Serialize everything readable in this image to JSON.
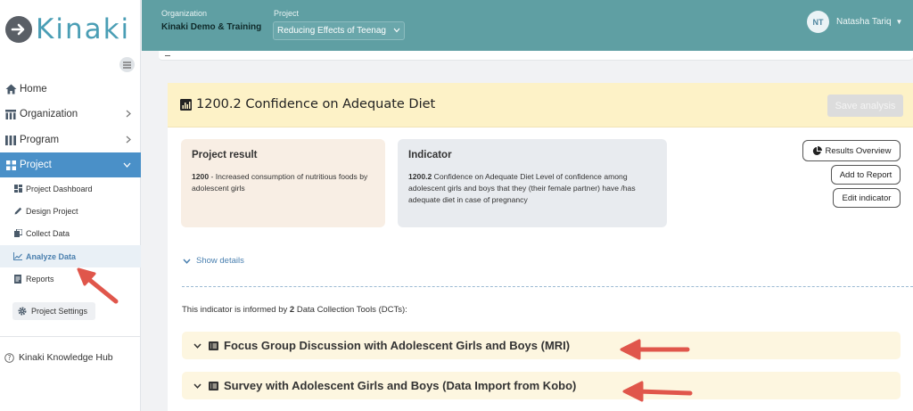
{
  "brand": {
    "name": "Kinaki"
  },
  "sidebar": {
    "nav": [
      {
        "label": "Home",
        "icon": "home-icon",
        "has_chevron": false
      },
      {
        "label": "Organization",
        "icon": "organization-icon",
        "has_chevron": true
      },
      {
        "label": "Program",
        "icon": "program-icon",
        "has_chevron": true
      },
      {
        "label": "Project",
        "icon": "project-icon",
        "has_chevron": true,
        "active": true
      }
    ],
    "project_items": [
      {
        "label": "Project Dashboard",
        "icon": "dashboard-icon"
      },
      {
        "label": "Design Project",
        "icon": "pencil-icon"
      },
      {
        "label": "Collect Data",
        "icon": "collect-data-icon"
      },
      {
        "label": "Analyze Data",
        "icon": "chart-line-icon",
        "current": true
      },
      {
        "label": "Reports",
        "icon": "report-icon"
      }
    ],
    "settings_label": "Project Settings",
    "knowledge_hub_label": "Kinaki Knowledge Hub"
  },
  "header": {
    "organization_label": "Organization",
    "organization_value": "Kinaki Demo & Training",
    "project_label": "Project",
    "project_value": "Reducing Effects of Teenag",
    "user_initials": "NT",
    "user_name": "Natasha Tariq"
  },
  "card": {
    "title": "1200.2 Confidence on Adequate Diet",
    "save_label": "Save analysis",
    "project_result": {
      "heading": "Project result",
      "code": "1200",
      "text": " - Increased consumption of nutritious foods by adolescent girls"
    },
    "indicator": {
      "heading": "Indicator",
      "code": "1200.2",
      "text": " Confidence on Adequate Diet Level of confidence among adolescent girls and boys that they (their female partner) have /has adequate diet in case of pregnancy"
    },
    "buttons": {
      "results_overview": "Results Overview",
      "add_to_report": "Add to Report",
      "edit_indicator": "Edit indicator"
    },
    "show_details": "Show details",
    "informed": {
      "prefix": "This indicator is informed by ",
      "count": "2",
      "suffix": " Data Collection Tools (DCTs):"
    },
    "dcts": [
      "Focus Group Discussion with Adolescent Girls and Boys (MRI)",
      "Survey with Adolescent Girls and Boys (Data Import from Kobo)"
    ]
  },
  "colors": {
    "topbar": "#5f9fa3",
    "active_nav": "#4a90c8",
    "brand_text": "#4a9eb5",
    "card_header": "#fdf2c7",
    "annotation_arrow": "#e0564b"
  }
}
